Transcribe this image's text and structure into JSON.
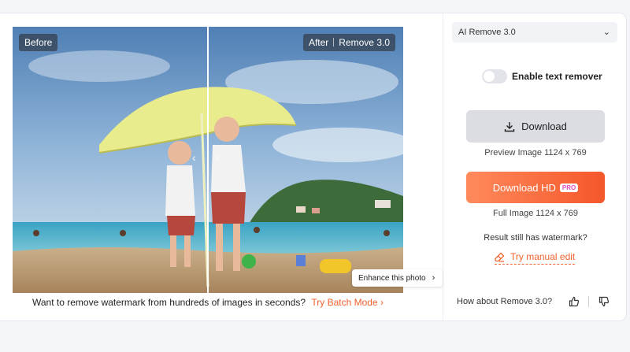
{
  "compare": {
    "before_label": "Before",
    "after_label": "After",
    "after_version": "Remove 3.0",
    "enhance_label": "Enhance this photo"
  },
  "batch": {
    "text": "Want to remove watermark from hundreds of images in seconds?",
    "link": "Try Batch Mode",
    "link_chevron": "›"
  },
  "panel": {
    "model_select": "AI Remove 3.0",
    "toggle_label": "Enable text remover",
    "toggle_on": false,
    "download_label": "Download",
    "preview_caption": "Preview Image 1124 x 769",
    "download_hd_label": "Download HD",
    "pro_badge": "PRO",
    "full_caption": "Full Image 1124 x 769",
    "question": "Result still has watermark?",
    "manual_edit": "Try manual edit",
    "feedback_question": "How about Remove 3.0?"
  },
  "colors": {
    "accent": "#f0622d",
    "hd_gradient_start": "#ff8a5c",
    "hd_gradient_end": "#f4572a",
    "pro_text": "#e04fbf"
  },
  "icons": {
    "download": "download-icon",
    "edit": "eraser-icon",
    "thumbs_up": "thumbs-up-icon",
    "thumbs_down": "thumbs-down-icon",
    "chevron": "chevron-down-icon"
  }
}
